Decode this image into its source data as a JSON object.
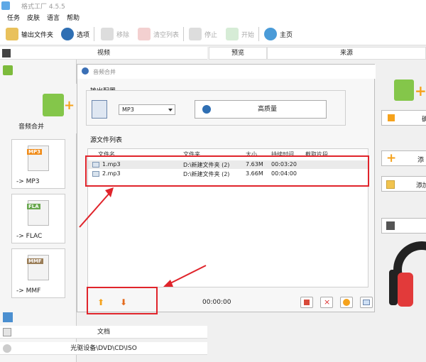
{
  "window": {
    "title": "格式工厂 4.5.5"
  },
  "menu": [
    "任务",
    "皮肤",
    "语言",
    "帮助"
  ],
  "toolbar": {
    "output_folder": "输出文件夹",
    "options": "选项",
    "remove": "移除",
    "clear_list": "清空列表",
    "stop": "停止",
    "start": "开始",
    "home": "主页"
  },
  "left_panel": {
    "video_label": "视频",
    "merge_audio_tile": "音频合并",
    "tiles": [
      "-> MP3",
      "-> FLAC",
      "-> MMF"
    ],
    "tile_tags": [
      "MP3",
      "FLA",
      "MMF"
    ],
    "document_label": "文档",
    "optical_label": "光驱设备\\DVD\\CD\\ISO"
  },
  "headers": {
    "preview": "预览",
    "source": "来源"
  },
  "dialog": {
    "title": "音频合并",
    "output_config": "输出配置",
    "format_select": "MP3",
    "quality_button": "高质量",
    "source_list_label": "源文件列表",
    "columns": [
      "文件名",
      "文件夹",
      "大小",
      "持续时间",
      "截取片段"
    ],
    "files": [
      {
        "name": "1.mp3",
        "folder": "D:\\新建文件夹 (2)",
        "size": "7.63M",
        "duration": "00:03:20"
      },
      {
        "name": "2.mp3",
        "folder": "D:\\新建文件夹 (2)",
        "size": "3.66M",
        "duration": "00:04:00"
      }
    ],
    "total_time": "00:00:00"
  },
  "right_panel": {
    "btn1": "确",
    "btn2": "添",
    "btn3": "添加",
    "btn4": ""
  },
  "colors": {
    "annotation_red": "#e0242b",
    "accent_orange": "#f5a21c"
  }
}
